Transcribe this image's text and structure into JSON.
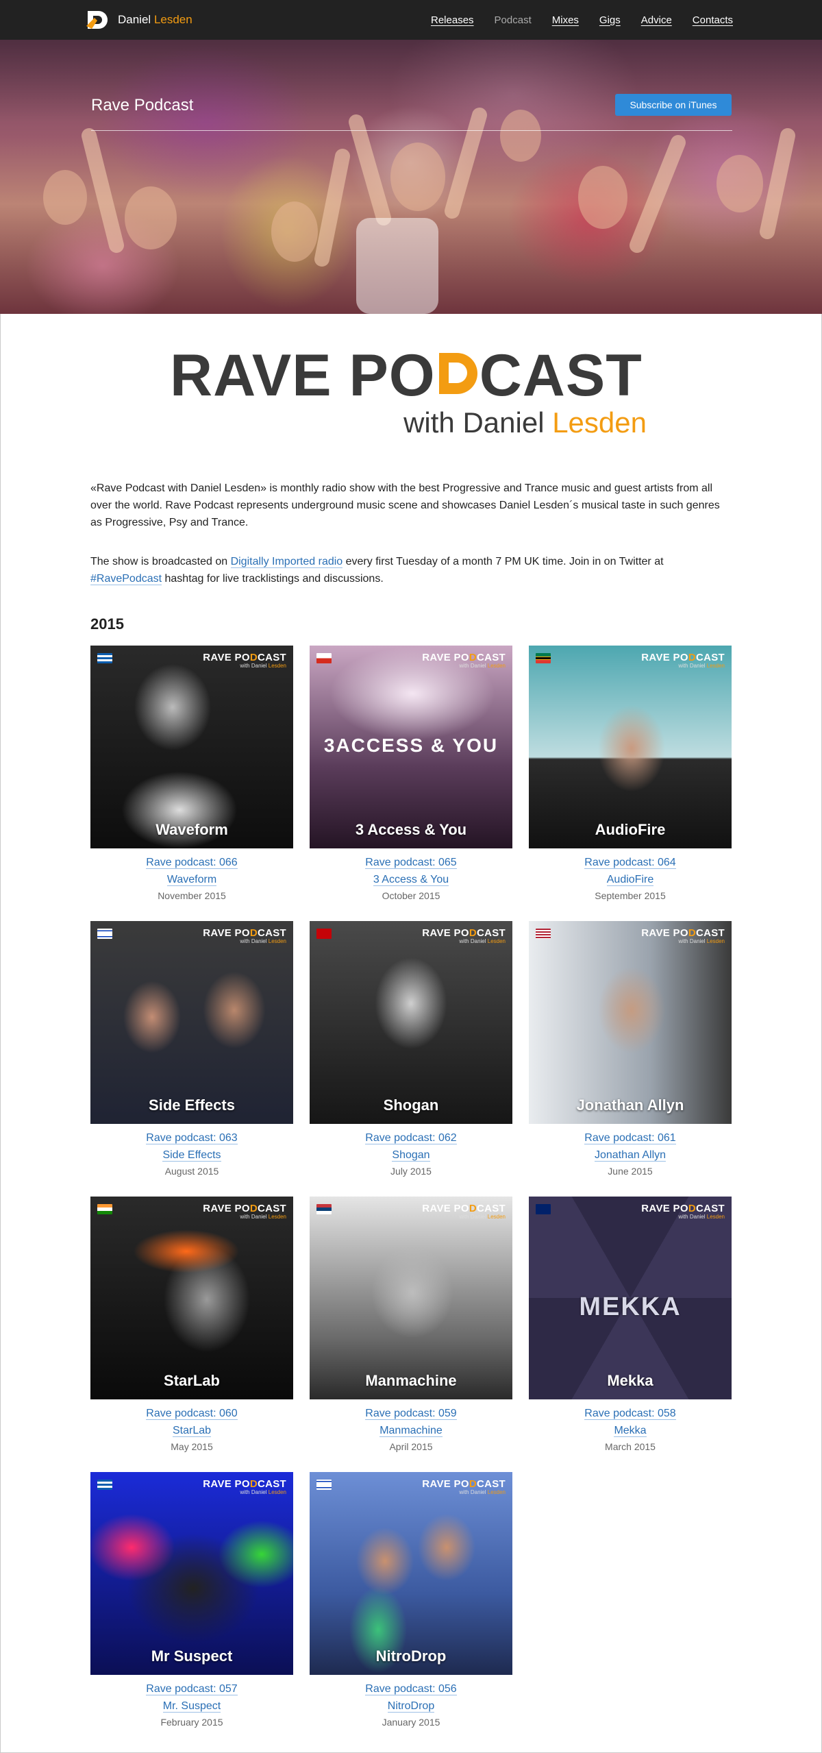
{
  "nav": {
    "logo_first": "Daniel",
    "logo_last": "Lesden",
    "links": [
      "Releases",
      "Podcast",
      "Mixes",
      "Gigs",
      "Advice",
      "Contacts"
    ]
  },
  "hero": {
    "title": "Rave Podcast",
    "subscribe_label": "Subscribe on iTunes"
  },
  "big_logo": {
    "line1_a": "RAVE PO",
    "line1_b": "CAST",
    "line2_a": "with Daniel",
    "line2_b": "Lesden"
  },
  "intro": {
    "p1": "«Rave Podcast with Daniel Lesden» is monthly radio show with the best Progressive and Trance music and guest artists from all over the world. Rave Podcast represents underground music scene and showcases Daniel Lesden´s musical taste in such genres as Progressive, Psy and Trance.",
    "p2_a": "The show is broadcasted on ",
    "p2_link": "Digitally Imported radio",
    "p2_b": " every first Tuesday of a month 7 PM UK time. Join in on Twitter at ",
    "p2_hashtag": "#RavePodcast",
    "p2_c": " hashtag for live tracklistings and discussions."
  },
  "year": "2015",
  "thumb_logo": {
    "a": "RAVE PO",
    "b": "CAST",
    "sub_a": "with Daniel ",
    "sub_b": "Lesden"
  },
  "episodes": [
    {
      "caption": "Waveform",
      "episode": "Rave podcast: 066",
      "artist": "Waveform",
      "date": "November 2015"
    },
    {
      "caption": "3 Access & You",
      "episode": "Rave podcast: 065",
      "artist": "3 Access & You",
      "date": "October 2015",
      "art_text": "3ACCESS & YOU"
    },
    {
      "caption": "AudioFire",
      "episode": "Rave podcast: 064",
      "artist": "AudioFire",
      "date": "September 2015"
    },
    {
      "caption": "Side Effects",
      "episode": "Rave podcast: 063",
      "artist": "Side Effects",
      "date": "August 2015"
    },
    {
      "caption": "Shogan",
      "episode": "Rave podcast: 062",
      "artist": "Shogan",
      "date": "July 2015"
    },
    {
      "caption": "Jonathan Allyn",
      "episode": "Rave podcast: 061",
      "artist": "Jonathan Allyn",
      "date": "June 2015"
    },
    {
      "caption": "StarLab",
      "episode": "Rave podcast: 060",
      "artist": "StarLab",
      "date": "May 2015"
    },
    {
      "caption": "Manmachine",
      "episode": "Rave podcast: 059",
      "artist": "Manmachine",
      "date": "April 2015"
    },
    {
      "caption": "Mekka",
      "episode": "Rave podcast: 058",
      "artist": "Mekka",
      "date": "March 2015",
      "art_text": "MEKKA"
    },
    {
      "caption": "Mr Suspect",
      "episode": "Rave podcast: 057",
      "artist": "Mr. Suspect",
      "date": "February 2015"
    },
    {
      "caption": "NitroDrop",
      "episode": "Rave podcast: 056",
      "artist": "NitroDrop",
      "date": "January 2015"
    }
  ]
}
